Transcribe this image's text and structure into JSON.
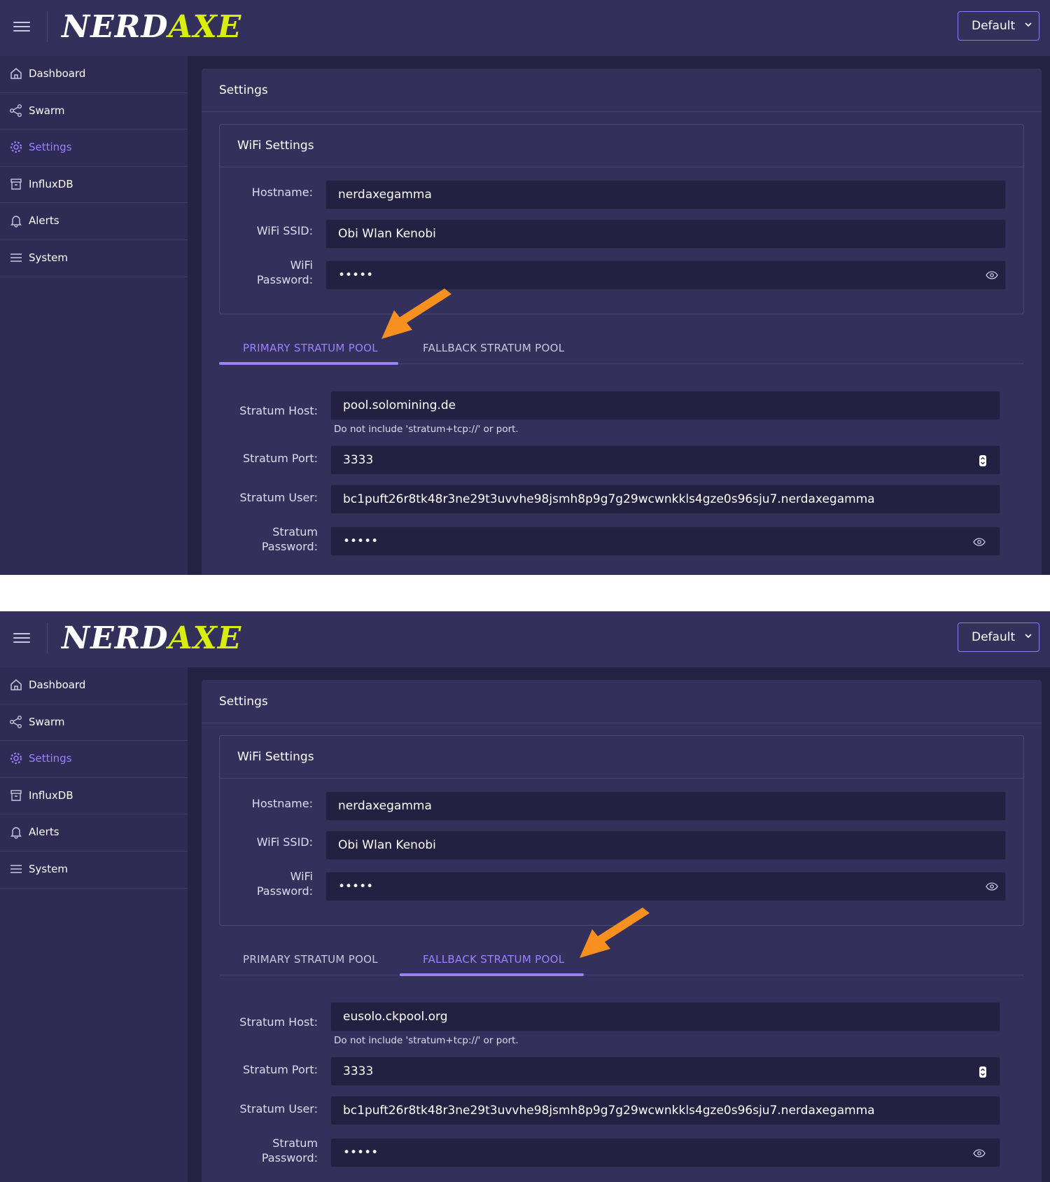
{
  "colors": {
    "background": "#242243",
    "topbar": "#33315b",
    "sidebar": "#2e2c54",
    "accent": "#9d80ff",
    "logo_accent": "#d9ee0d",
    "annotation_arrow": "#f7901e"
  },
  "screens": [
    {
      "app": {
        "logo_part1": "NERD",
        "logo_part2": "AXE",
        "theme": "Default"
      },
      "sidebar": {
        "items": [
          {
            "label": "Dashboard",
            "icon": "home-icon"
          },
          {
            "label": "Swarm",
            "icon": "share-icon"
          },
          {
            "label": "Settings",
            "icon": "gear-icon",
            "active": true
          },
          {
            "label": "InfluxDB",
            "icon": "database-icon"
          },
          {
            "label": "Alerts",
            "icon": "bell-icon"
          },
          {
            "label": "System",
            "icon": "list-icon"
          }
        ]
      },
      "settings": {
        "title": "Settings",
        "wifi": {
          "title": "WiFi Settings",
          "hostname_label": "Hostname:",
          "hostname": "nerdaxegamma",
          "ssid_label": "WiFi SSID:",
          "ssid": "Obi Wlan Kenobi",
          "password_label_1": "WiFi",
          "password_label_2": "Password:",
          "password": "•••••"
        },
        "tabs": [
          {
            "label": "PRIMARY STRATUM POOL",
            "active": true
          },
          {
            "label": "FALLBACK STRATUM POOL",
            "active": false
          }
        ],
        "stratum": {
          "host_label": "Stratum Host:",
          "host": "pool.solomining.de",
          "hint": "Do not include 'stratum+tcp://' or port.",
          "port_label": "Stratum Port:",
          "port": "3333",
          "user_label": "Stratum User:",
          "user": "bc1puft26r8tk48r3ne29t3uvvhe98jsmh8p9g7g29wcwnkkls4gze0s96sju7.nerdaxegamma",
          "password_label_1": "Stratum",
          "password_label_2": "Password:",
          "password": "•••••"
        }
      }
    },
    {
      "app": {
        "logo_part1": "NERD",
        "logo_part2": "AXE",
        "theme": "Default"
      },
      "sidebar": {
        "items": [
          {
            "label": "Dashboard",
            "icon": "home-icon"
          },
          {
            "label": "Swarm",
            "icon": "share-icon"
          },
          {
            "label": "Settings",
            "icon": "gear-icon",
            "active": true
          },
          {
            "label": "InfluxDB",
            "icon": "database-icon"
          },
          {
            "label": "Alerts",
            "icon": "bell-icon"
          },
          {
            "label": "System",
            "icon": "list-icon"
          }
        ]
      },
      "settings": {
        "title": "Settings",
        "wifi": {
          "title": "WiFi Settings",
          "hostname_label": "Hostname:",
          "hostname": "nerdaxegamma",
          "ssid_label": "WiFi SSID:",
          "ssid": "Obi Wlan Kenobi",
          "password_label_1": "WiFi",
          "password_label_2": "Password:",
          "password": "•••••"
        },
        "tabs": [
          {
            "label": "PRIMARY STRATUM POOL",
            "active": false
          },
          {
            "label": "FALLBACK STRATUM POOL",
            "active": true
          }
        ],
        "stratum": {
          "host_label": "Stratum Host:",
          "host": "eusolo.ckpool.org",
          "hint": "Do not include 'stratum+tcp://' or port.",
          "port_label": "Stratum Port:",
          "port": "3333",
          "user_label": "Stratum User:",
          "user": "bc1puft26r8tk48r3ne29t3uvvhe98jsmh8p9g7g29wcwnkkls4gze0s96sju7.nerdaxegamma",
          "password_label_1": "Stratum",
          "password_label_2": "Password:",
          "password": "•••••"
        }
      }
    }
  ]
}
